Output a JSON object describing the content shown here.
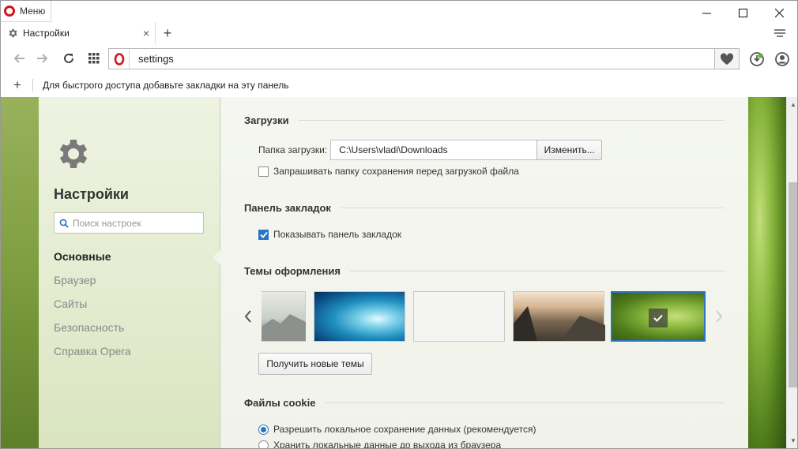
{
  "window": {
    "menu_label": "Меню"
  },
  "tab": {
    "title": "Настройки",
    "close": "×",
    "new_tab": "+"
  },
  "address": {
    "url": "settings"
  },
  "bookmarks_bar": {
    "add": "+",
    "hint": "Для быстрого доступа добавьте закладки на эту панель"
  },
  "sidebar": {
    "title": "Настройки",
    "search_placeholder": "Поиск настроек",
    "items": [
      {
        "label": "Основные",
        "active": true
      },
      {
        "label": "Браузер",
        "active": false
      },
      {
        "label": "Сайты",
        "active": false
      },
      {
        "label": "Безопасность",
        "active": false
      },
      {
        "label": "Справка Opera",
        "active": false
      }
    ]
  },
  "downloads": {
    "heading": "Загрузки",
    "folder_label": "Папка загрузки:",
    "folder_path": "C:\\Users\\vladi\\Downloads",
    "change_button": "Изменить...",
    "ask_folder_label": "Запрашивать папку сохранения перед загрузкой файла",
    "ask_folder_checked": false
  },
  "bookmarks_panel": {
    "heading": "Панель закладок",
    "show_label": "Показывать панель закладок",
    "show_checked": true
  },
  "themes": {
    "heading": "Темы оформления",
    "get_button": "Получить новые темы",
    "items": [
      {
        "name": "partial-mountains-theme",
        "selected": false
      },
      {
        "name": "blue-waves-theme",
        "selected": false
      },
      {
        "name": "blank-light-theme",
        "selected": false
      },
      {
        "name": "mountain-sunset-theme",
        "selected": false
      },
      {
        "name": "green-leaf-theme",
        "selected": true
      }
    ]
  },
  "cookies": {
    "heading": "Файлы cookie",
    "options": [
      {
        "label": "Разрешить локальное сохранение данных (рекомендуется)",
        "checked": true
      },
      {
        "label": "Хранить локальные данные до выхода из браузера",
        "checked": false
      }
    ]
  },
  "colors": {
    "opera_red": "#d0161c",
    "accent_blue": "#2a74c4"
  }
}
